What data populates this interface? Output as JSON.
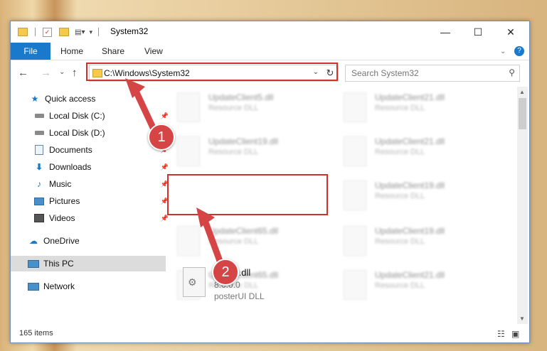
{
  "window": {
    "title": "System32",
    "controls": {
      "minimize": "—",
      "maximize": "☐",
      "close": "✕"
    }
  },
  "ribbon": {
    "file": "File",
    "tabs": [
      "Home",
      "Share",
      "View"
    ]
  },
  "nav": {
    "back": "←",
    "forward": "→",
    "recent": "⌄",
    "up": "↑",
    "address": "C:\\Windows\\System32",
    "search_placeholder": "Search System32"
  },
  "sidebar": {
    "items": [
      {
        "label": "Quick access",
        "icon": "star-icon"
      },
      {
        "label": "Local Disk (C:)",
        "icon": "drive-icon"
      },
      {
        "label": "Local Disk (D:)",
        "icon": "drive-icon"
      },
      {
        "label": "Documents",
        "icon": "documents-icon"
      },
      {
        "label": "Downloads",
        "icon": "download-icon"
      },
      {
        "label": "Music",
        "icon": "music-icon"
      },
      {
        "label": "Pictures",
        "icon": "pictures-icon"
      },
      {
        "label": "Videos",
        "icon": "videos-icon"
      },
      {
        "label": "OneDrive",
        "icon": "cloud-icon"
      },
      {
        "label": "This PC",
        "icon": "computer-icon"
      },
      {
        "label": "Network",
        "icon": "network-icon"
      }
    ]
  },
  "files": [
    {
      "name": "UpdateClient5.dll",
      "desc": "Resource DLL"
    },
    {
      "name": "UpdateClient21.dll",
      "desc": "Resource DLL"
    },
    {
      "name": "UpdateClient19.dll",
      "desc": "Resource DLL"
    },
    {
      "name": "UpdateClient21.dll",
      "desc": "Resource DLL"
    },
    {
      "name": "UpdateClient19.dll",
      "desc": "Resource DLL"
    },
    {
      "name": "UpdateClient65.dll",
      "desc": "Resource DLL"
    },
    {
      "name": "UpdateClient19.dll",
      "desc": "Resource DLL"
    },
    {
      "name": "UpdateClient65.dll",
      "desc": "Resource DLL"
    },
    {
      "name": "UpdateClient21.dll",
      "desc": "Resource DLL"
    }
  ],
  "highlight_file": {
    "name": "postui.dll",
    "version": "8.0.0.0",
    "desc": "posterUI DLL"
  },
  "status": {
    "count": "165 items"
  },
  "badges": [
    "1",
    "2"
  ],
  "colors": {
    "accent": "#1979ca",
    "highlight": "#d32f2f",
    "badge": "#d64545"
  }
}
